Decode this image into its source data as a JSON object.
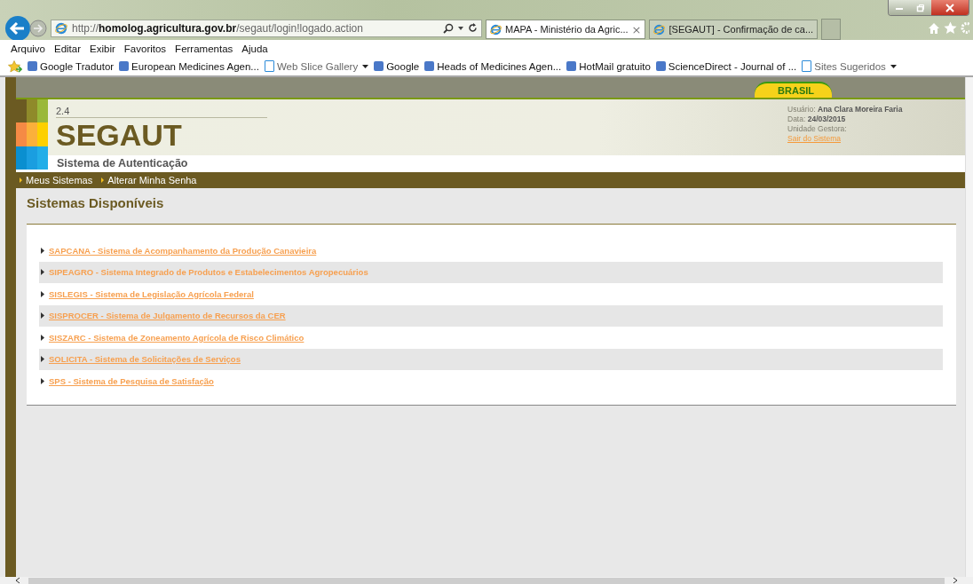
{
  "browser": {
    "url": "http://**homolog.agricultura.gov.br**/segaut/login!logado.action",
    "tabs": [
      {
        "title": "MAPA - Ministério da Agric...",
        "selected": true,
        "close": "×"
      },
      {
        "title": "[SEGAUT] - Confirmação de ca...",
        "selected": false
      }
    ],
    "menu": [
      "Arquivo",
      "Editar",
      "Exibir",
      "Favoritos",
      "Ferramentas",
      "Ajuda"
    ],
    "favorites": [
      {
        "label": "Google Tradutor",
        "dropdown": false
      },
      {
        "label": "European Medicines Agen...",
        "dropdown": false
      },
      {
        "label": "Web Slice Gallery",
        "dropdown": true
      },
      {
        "label": "Google",
        "dropdown": false
      },
      {
        "label": "Heads of Medicines Agen...",
        "dropdown": false
      },
      {
        "label": "HotMail gratuito",
        "dropdown": false
      },
      {
        "label": "ScienceDirect - Journal of ...",
        "dropdown": false
      },
      {
        "label": "Sites Sugeridos",
        "dropdown": true
      }
    ]
  },
  "page": {
    "brand": "BRASIL",
    "version": "2.4",
    "app_name": "SEGAUT",
    "app_subtitle": "Sistema de Autenticação",
    "user_info": [
      {
        "label": "Usuário:",
        "value": "Ana Clara Moreira Faria"
      },
      {
        "label": "Data:",
        "value": "24/03/2015"
      },
      {
        "label": "Unidade Gestora:"
      }
    ],
    "logout": "Sair do Sistema",
    "nav": [
      "Meus Sistemas",
      "Alterar Minha Senha"
    ],
    "heading": "Sistemas Disponíveis",
    "systems": [
      {
        "label": "SAPCANA - Sistema de Acompanhamento da Produção Canavieira",
        "underlined": true
      },
      {
        "label": "SIPEAGRO - Sistema Integrado de Produtos e Estabelecimentos Agropecuários",
        "underlined": false
      },
      {
        "label": "SISLEGIS - Sistema de Legislação Agrícola Federal",
        "underlined": true
      },
      {
        "label": "SISPROCER - Sistema de Julgamento de Recursos da CER",
        "underlined": true
      },
      {
        "label": "SISZARC - Sistema de Zoneamento Agrícola de Risco Climático",
        "underlined": true
      },
      {
        "label": "SOLICITA - Sistema de Solicitações de Serviços",
        "underlined": true
      },
      {
        "label": "SPS - Sistema de Pesquisa de Satisfação",
        "underlined": true
      }
    ]
  }
}
